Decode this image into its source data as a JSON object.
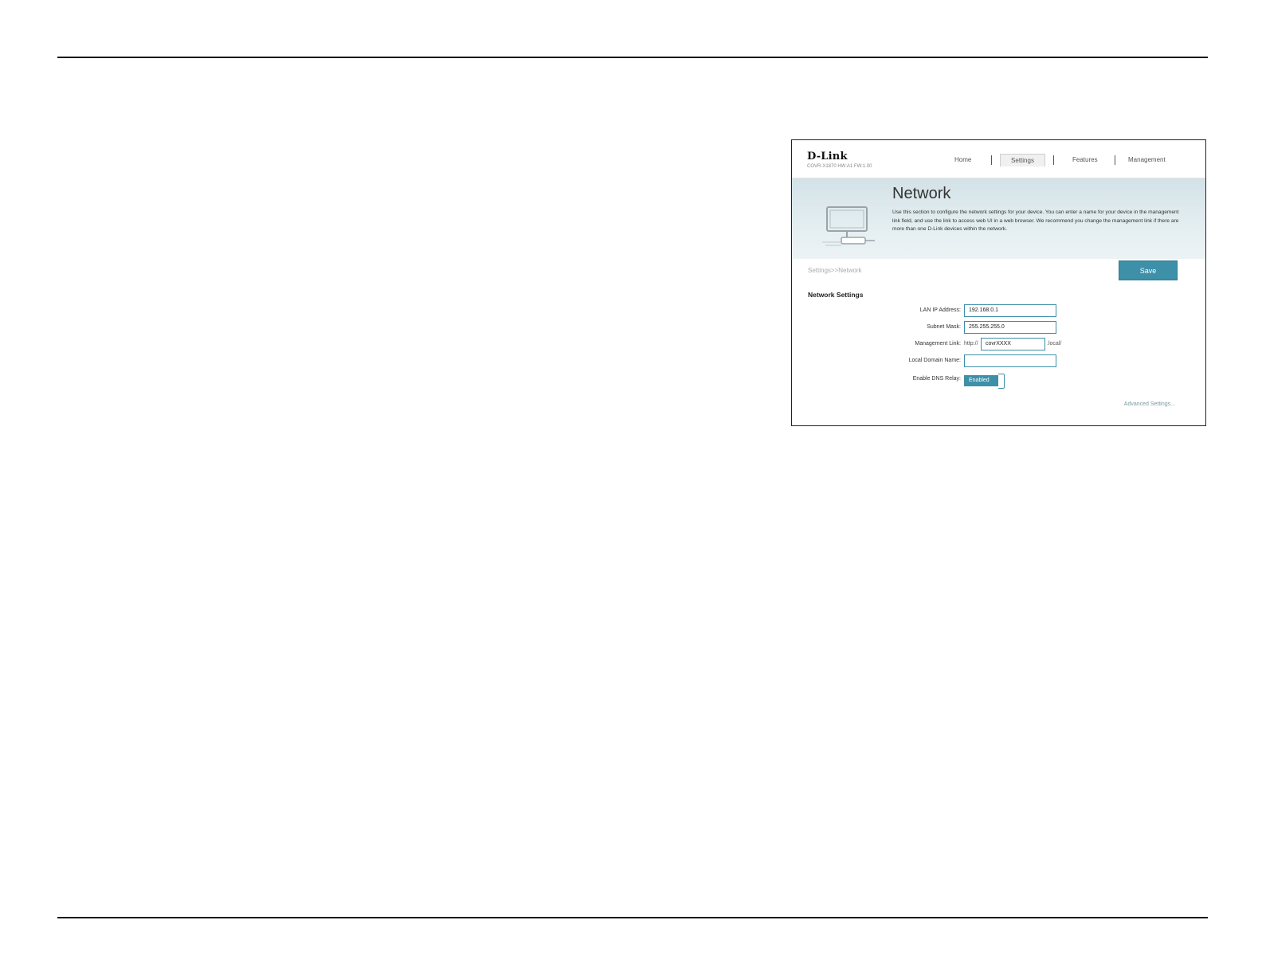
{
  "header": {
    "brand": "D-Link",
    "firmware": "COVR-X1870 HW:A1 FW:1.00",
    "nav": {
      "home": "Home",
      "settings": "Settings",
      "features": "Features",
      "management": "Management"
    }
  },
  "banner": {
    "title": "Network",
    "description": "Use this section to configure the network settings for your device. You can enter a name for your device in the management link field, and use the link to access web UI in a web browser. We recommend you change the management link if there are more than one D-Link devices within the network."
  },
  "breadcrumb": "Settings>>Network",
  "save_label": "Save",
  "section_title": "Network Settings",
  "form": {
    "lan_ip_label": "LAN IP Address:",
    "lan_ip_value": "192.168.0.1",
    "subnet_label": "Subnet Mask:",
    "subnet_value": "255.255.255.0",
    "mgmt_label": "Management Link:",
    "mgmt_prefix": "http://",
    "mgmt_value": "covrXXXX",
    "mgmt_suffix": ".local/",
    "domain_label": "Local Domain Name:",
    "domain_value": "",
    "dns_label": "Enable DNS Relay:",
    "dns_state": "Enabled"
  },
  "advanced_link": "Advanced Settings...",
  "colors": {
    "accent": "#3e8fa8",
    "banner": "#dde9ed"
  }
}
